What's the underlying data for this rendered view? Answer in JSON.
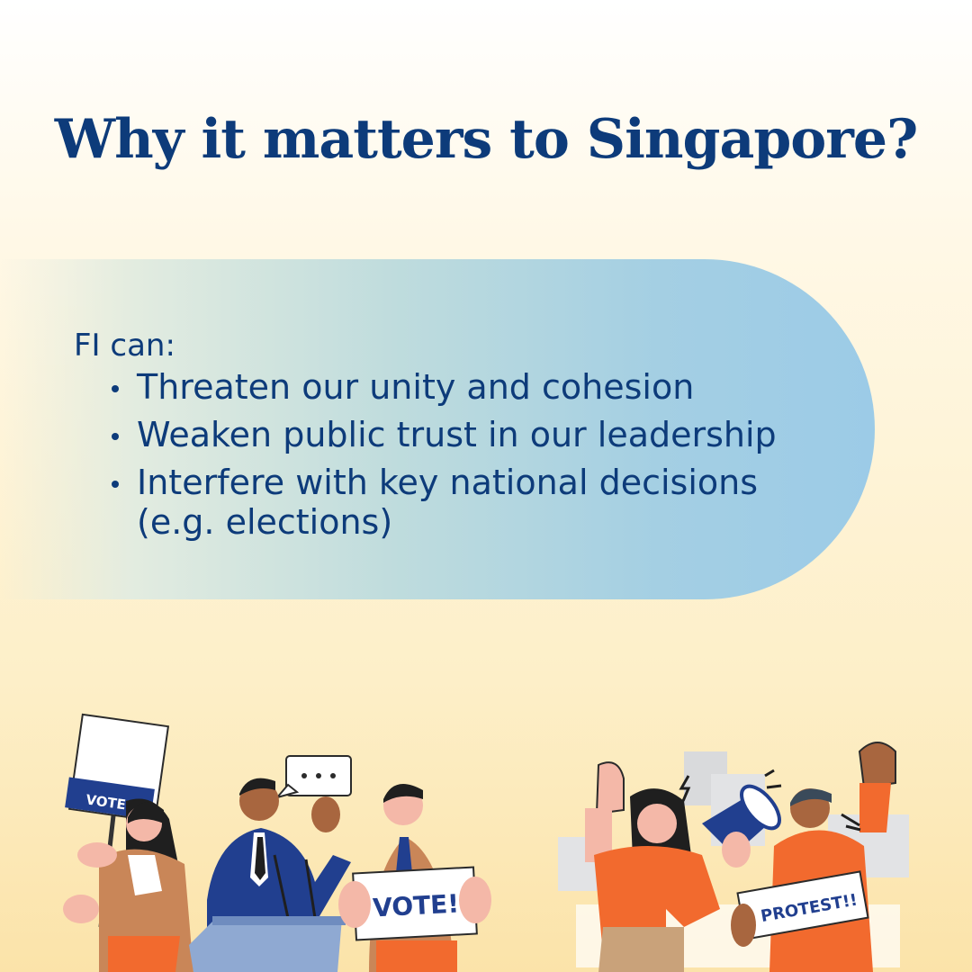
{
  "title": "Why it matters to Singapore?",
  "intro": "FI can:",
  "points": [
    "Threaten our unity and cohesion",
    "Weaken public trust in our leadership",
    "Interfere with key national decisions (e.g. elections)"
  ],
  "illustration_left": {
    "sign_woman": "VOTE!",
    "sign_man": "VOTE!",
    "speech_bubble": "..."
  },
  "illustration_right": {
    "sign": "PROTEST!!"
  },
  "colors": {
    "title": "#0d3b7a",
    "text": "#0d3b7a",
    "accent_orange": "#f26a2e",
    "navy": "#213f8f"
  }
}
